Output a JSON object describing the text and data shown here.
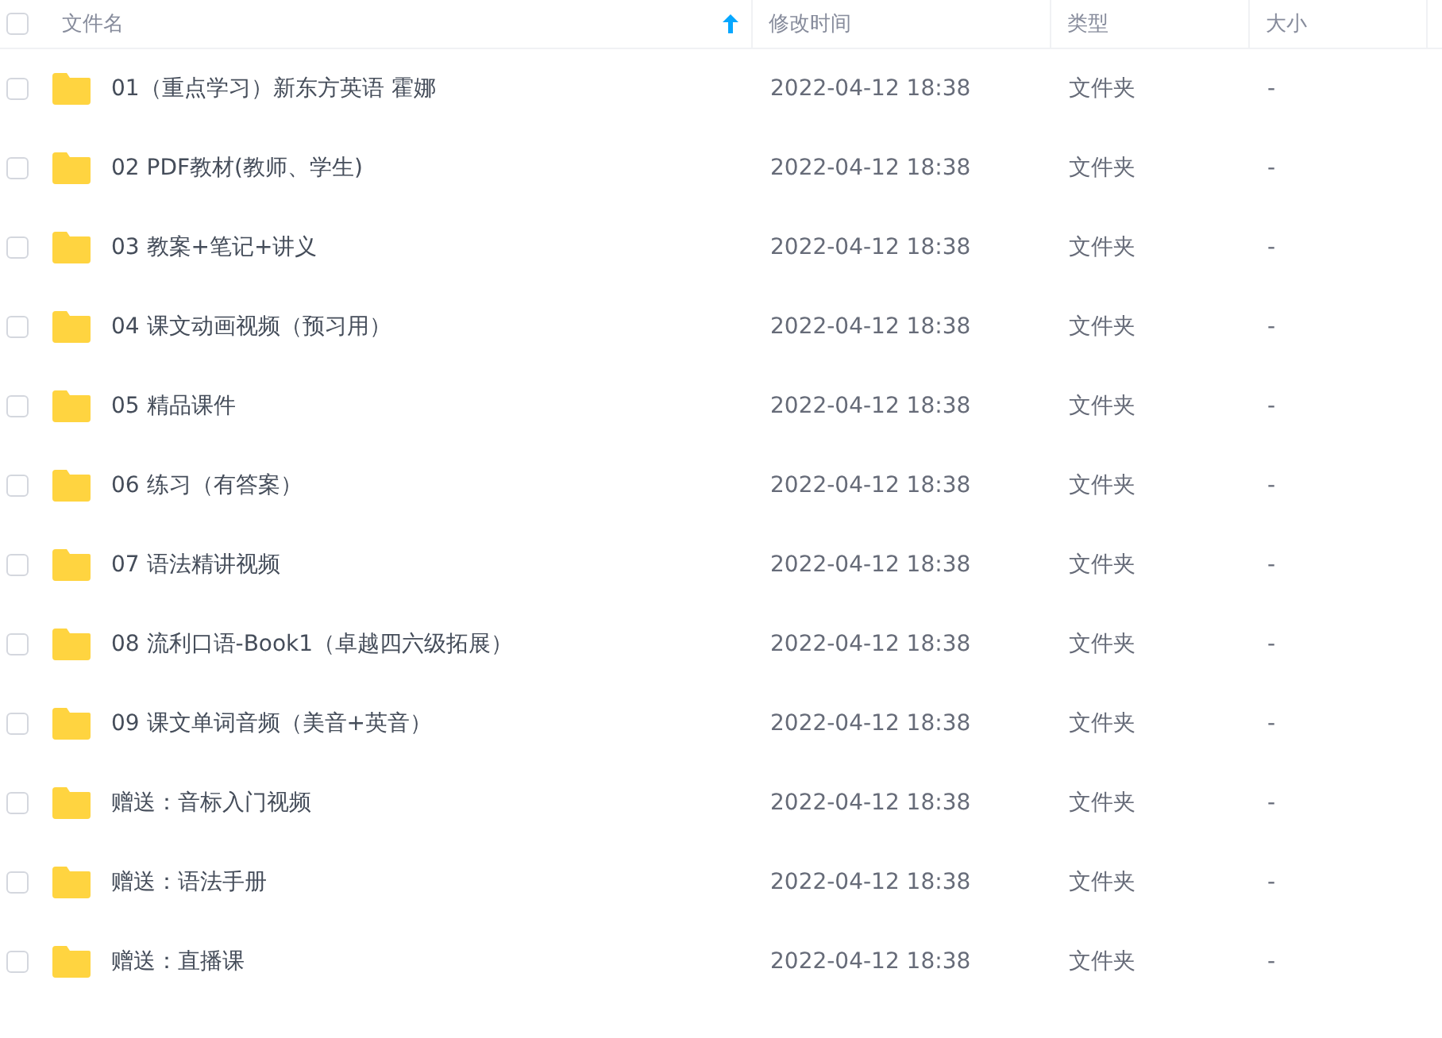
{
  "table": {
    "select_all": {
      "checked": false
    },
    "columns": [
      {
        "label": "文件名",
        "sorted": true
      },
      {
        "label": "修改时间",
        "sorted": false
      },
      {
        "label": "类型",
        "sorted": false
      },
      {
        "label": "大小",
        "sorted": false
      }
    ],
    "rows": [
      {
        "checked": false,
        "name": "01（重点学习）新东方英语 霍娜",
        "modified": "2022-04-12 18:38",
        "type": "文件夹",
        "size": "-"
      },
      {
        "checked": false,
        "name": "02 PDF教材(教师、学生)",
        "modified": "2022-04-12 18:38",
        "type": "文件夹",
        "size": "-"
      },
      {
        "checked": false,
        "name": "03 教案+笔记+讲义",
        "modified": "2022-04-12 18:38",
        "type": "文件夹",
        "size": "-"
      },
      {
        "checked": false,
        "name": "04 课文动画视频（预习用）",
        "modified": "2022-04-12 18:38",
        "type": "文件夹",
        "size": "-"
      },
      {
        "checked": false,
        "name": "05 精品课件",
        "modified": "2022-04-12 18:38",
        "type": "文件夹",
        "size": "-"
      },
      {
        "checked": false,
        "name": "06 练习（有答案）",
        "modified": "2022-04-12 18:38",
        "type": "文件夹",
        "size": "-"
      },
      {
        "checked": false,
        "name": "07 语法精讲视频",
        "modified": "2022-04-12 18:38",
        "type": "文件夹",
        "size": "-"
      },
      {
        "checked": false,
        "name": "08 流利口语-Book1（卓越四六级拓展）",
        "modified": "2022-04-12 18:38",
        "type": "文件夹",
        "size": "-"
      },
      {
        "checked": false,
        "name": "09 课文单词音频（美音+英音）",
        "modified": "2022-04-12 18:38",
        "type": "文件夹",
        "size": "-"
      },
      {
        "checked": false,
        "name": "赠送：音标入门视频",
        "modified": "2022-04-12 18:38",
        "type": "文件夹",
        "size": "-"
      },
      {
        "checked": false,
        "name": "赠送：语法手册",
        "modified": "2022-04-12 18:38",
        "type": "文件夹",
        "size": "-"
      },
      {
        "checked": false,
        "name": "赠送：直播课",
        "modified": "2022-04-12 18:38",
        "type": "文件夹",
        "size": "-"
      }
    ]
  }
}
